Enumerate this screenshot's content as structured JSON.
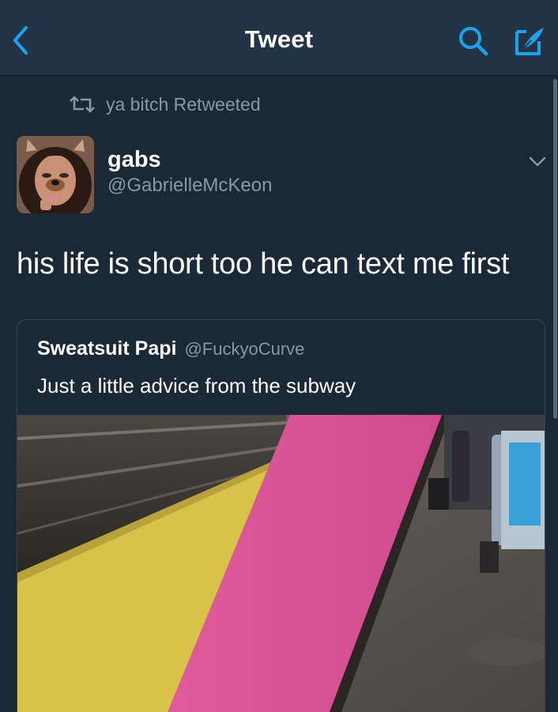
{
  "nav": {
    "title": "Tweet",
    "back_icon": "chevron-left-icon",
    "search_icon": "search-icon",
    "compose_icon": "compose-icon",
    "accent_color": "#1da1f2"
  },
  "retweet": {
    "label": "ya bitch Retweeted",
    "icon": "retweet-icon"
  },
  "tweet": {
    "author_name": "gabs",
    "author_handle": "@GabrielleMcKeon",
    "text": "his life is short too he can text me first",
    "menu_icon": "chevron-down-icon"
  },
  "quote": {
    "author_name": "Sweatsuit Papi",
    "author_handle": "@FuckyoCurve",
    "text": "Just a little advice from the subway"
  },
  "colors": {
    "background": "#1b2836",
    "navbar": "#243447",
    "secondary_text": "#8899a6",
    "border": "#38444d"
  }
}
